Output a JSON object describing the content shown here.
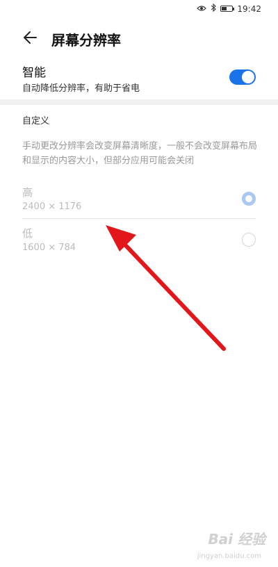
{
  "status_bar": {
    "time": "19:42",
    "icons": [
      "eye-icon",
      "bluetooth-icon",
      "battery-icon"
    ]
  },
  "header": {
    "title": "屏幕分辨率",
    "back_icon": "arrow-left-icon"
  },
  "smart": {
    "title": "智能",
    "description": "自动降低分辨率，有助于省电",
    "enabled": true,
    "accent_color": "#1a73e8"
  },
  "custom": {
    "section_title": "自定义",
    "description": "手动更改分辨率会改变屏幕清晰度，一般不会改变屏幕布局和显示的内容大小，但部分应用可能会关闭",
    "options": [
      {
        "label": "高",
        "resolution": "2400 × 1176",
        "selected": true
      },
      {
        "label": "低",
        "resolution": "1600 × 784",
        "selected": false
      }
    ]
  },
  "annotation": {
    "type": "arrow",
    "color": "#e3161b"
  },
  "watermark": {
    "logo": "Bai 经验",
    "url": "jingyan.baidu.com"
  }
}
